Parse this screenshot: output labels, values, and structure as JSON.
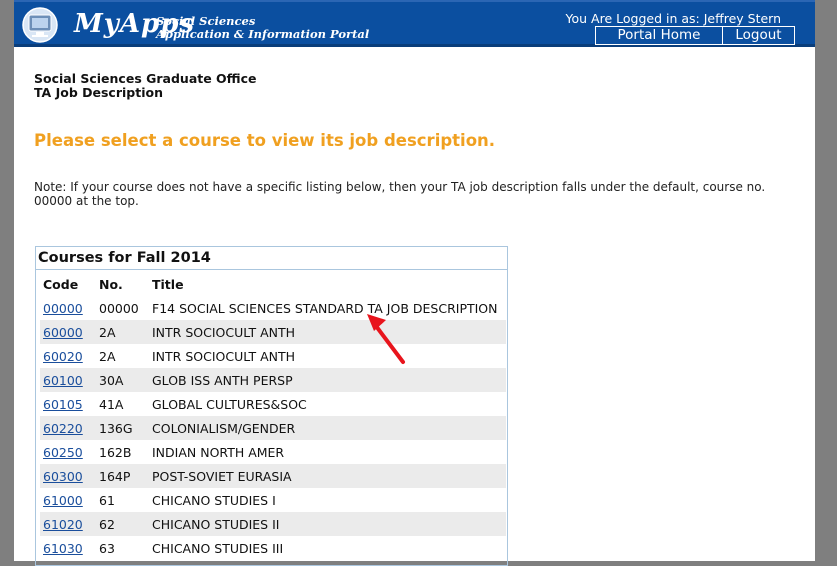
{
  "header": {
    "brand": "MyApps",
    "tagline_line1": "Social Sciences",
    "tagline_line2": "Application & Information Portal",
    "login_text": "You Are Logged in as: Jeffrey Stern",
    "nav": {
      "home": "Portal Home",
      "logout": "Logout"
    }
  },
  "office": {
    "name": "Social Sciences Graduate Office",
    "subtitle": "TA Job Description"
  },
  "prompt": "Please select a course to view its job description.",
  "note": "Note: If your course does not have a specific listing below, then your TA job description falls under the default, course no. 00000 at the top.",
  "courses": {
    "title": "Courses for Fall 2014",
    "columns": {
      "code": "Code",
      "no": "No.",
      "title": "Title"
    },
    "rows": [
      {
        "code": "00000",
        "no": "00000",
        "title": "F14 SOCIAL SCIENCES STANDARD TA JOB DESCRIPTION"
      },
      {
        "code": "60000",
        "no": "2A",
        "title": "INTR SOCIOCULT ANTH"
      },
      {
        "code": "60020",
        "no": "2A",
        "title": "INTR SOCIOCULT ANTH"
      },
      {
        "code": "60100",
        "no": "30A",
        "title": "GLOB ISS ANTH PERSP"
      },
      {
        "code": "60105",
        "no": "41A",
        "title": "GLOBAL CULTURES&SOC"
      },
      {
        "code": "60220",
        "no": "136G",
        "title": "COLONIALISM/GENDER"
      },
      {
        "code": "60250",
        "no": "162B",
        "title": "INDIAN NORTH AMER"
      },
      {
        "code": "60300",
        "no": "164P",
        "title": "POST-SOVIET EURASIA"
      },
      {
        "code": "61000",
        "no": "61",
        "title": "CHICANO STUDIES I"
      },
      {
        "code": "61020",
        "no": "62",
        "title": "CHICANO STUDIES II"
      },
      {
        "code": "61030",
        "no": "63",
        "title": "CHICANO STUDIES III"
      }
    ]
  },
  "colors": {
    "header_blue": "#0b4fa0",
    "prompt_orange": "#f0a020",
    "link_blue": "#1a4e9c",
    "arrow_red": "#e8141c"
  }
}
